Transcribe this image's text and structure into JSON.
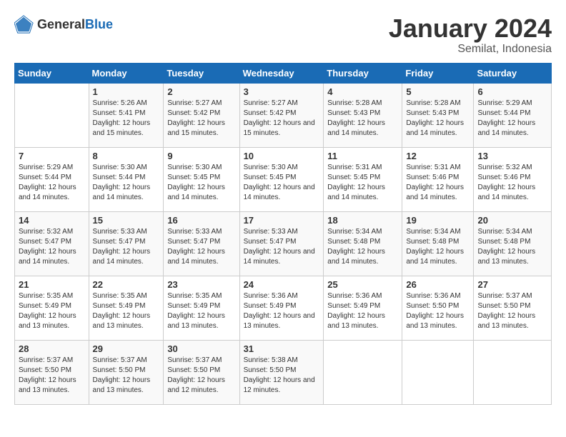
{
  "logo": {
    "general": "General",
    "blue": "Blue"
  },
  "title": "January 2024",
  "subtitle": "Semilat, Indonesia",
  "days_header": [
    "Sunday",
    "Monday",
    "Tuesday",
    "Wednesday",
    "Thursday",
    "Friday",
    "Saturday"
  ],
  "weeks": [
    [
      {
        "day": "",
        "sunrise": "",
        "sunset": "",
        "daylight": ""
      },
      {
        "day": "1",
        "sunrise": "Sunrise: 5:26 AM",
        "sunset": "Sunset: 5:41 PM",
        "daylight": "Daylight: 12 hours and 15 minutes."
      },
      {
        "day": "2",
        "sunrise": "Sunrise: 5:27 AM",
        "sunset": "Sunset: 5:42 PM",
        "daylight": "Daylight: 12 hours and 15 minutes."
      },
      {
        "day": "3",
        "sunrise": "Sunrise: 5:27 AM",
        "sunset": "Sunset: 5:42 PM",
        "daylight": "Daylight: 12 hours and 15 minutes."
      },
      {
        "day": "4",
        "sunrise": "Sunrise: 5:28 AM",
        "sunset": "Sunset: 5:43 PM",
        "daylight": "Daylight: 12 hours and 14 minutes."
      },
      {
        "day": "5",
        "sunrise": "Sunrise: 5:28 AM",
        "sunset": "Sunset: 5:43 PM",
        "daylight": "Daylight: 12 hours and 14 minutes."
      },
      {
        "day": "6",
        "sunrise": "Sunrise: 5:29 AM",
        "sunset": "Sunset: 5:44 PM",
        "daylight": "Daylight: 12 hours and 14 minutes."
      }
    ],
    [
      {
        "day": "7",
        "sunrise": "Sunrise: 5:29 AM",
        "sunset": "Sunset: 5:44 PM",
        "daylight": "Daylight: 12 hours and 14 minutes."
      },
      {
        "day": "8",
        "sunrise": "Sunrise: 5:30 AM",
        "sunset": "Sunset: 5:44 PM",
        "daylight": "Daylight: 12 hours and 14 minutes."
      },
      {
        "day": "9",
        "sunrise": "Sunrise: 5:30 AM",
        "sunset": "Sunset: 5:45 PM",
        "daylight": "Daylight: 12 hours and 14 minutes."
      },
      {
        "day": "10",
        "sunrise": "Sunrise: 5:30 AM",
        "sunset": "Sunset: 5:45 PM",
        "daylight": "Daylight: 12 hours and 14 minutes."
      },
      {
        "day": "11",
        "sunrise": "Sunrise: 5:31 AM",
        "sunset": "Sunset: 5:45 PM",
        "daylight": "Daylight: 12 hours and 14 minutes."
      },
      {
        "day": "12",
        "sunrise": "Sunrise: 5:31 AM",
        "sunset": "Sunset: 5:46 PM",
        "daylight": "Daylight: 12 hours and 14 minutes."
      },
      {
        "day": "13",
        "sunrise": "Sunrise: 5:32 AM",
        "sunset": "Sunset: 5:46 PM",
        "daylight": "Daylight: 12 hours and 14 minutes."
      }
    ],
    [
      {
        "day": "14",
        "sunrise": "Sunrise: 5:32 AM",
        "sunset": "Sunset: 5:47 PM",
        "daylight": "Daylight: 12 hours and 14 minutes."
      },
      {
        "day": "15",
        "sunrise": "Sunrise: 5:33 AM",
        "sunset": "Sunset: 5:47 PM",
        "daylight": "Daylight: 12 hours and 14 minutes."
      },
      {
        "day": "16",
        "sunrise": "Sunrise: 5:33 AM",
        "sunset": "Sunset: 5:47 PM",
        "daylight": "Daylight: 12 hours and 14 minutes."
      },
      {
        "day": "17",
        "sunrise": "Sunrise: 5:33 AM",
        "sunset": "Sunset: 5:47 PM",
        "daylight": "Daylight: 12 hours and 14 minutes."
      },
      {
        "day": "18",
        "sunrise": "Sunrise: 5:34 AM",
        "sunset": "Sunset: 5:48 PM",
        "daylight": "Daylight: 12 hours and 14 minutes."
      },
      {
        "day": "19",
        "sunrise": "Sunrise: 5:34 AM",
        "sunset": "Sunset: 5:48 PM",
        "daylight": "Daylight: 12 hours and 14 minutes."
      },
      {
        "day": "20",
        "sunrise": "Sunrise: 5:34 AM",
        "sunset": "Sunset: 5:48 PM",
        "daylight": "Daylight: 12 hours and 13 minutes."
      }
    ],
    [
      {
        "day": "21",
        "sunrise": "Sunrise: 5:35 AM",
        "sunset": "Sunset: 5:49 PM",
        "daylight": "Daylight: 12 hours and 13 minutes."
      },
      {
        "day": "22",
        "sunrise": "Sunrise: 5:35 AM",
        "sunset": "Sunset: 5:49 PM",
        "daylight": "Daylight: 12 hours and 13 minutes."
      },
      {
        "day": "23",
        "sunrise": "Sunrise: 5:35 AM",
        "sunset": "Sunset: 5:49 PM",
        "daylight": "Daylight: 12 hours and 13 minutes."
      },
      {
        "day": "24",
        "sunrise": "Sunrise: 5:36 AM",
        "sunset": "Sunset: 5:49 PM",
        "daylight": "Daylight: 12 hours and 13 minutes."
      },
      {
        "day": "25",
        "sunrise": "Sunrise: 5:36 AM",
        "sunset": "Sunset: 5:49 PM",
        "daylight": "Daylight: 12 hours and 13 minutes."
      },
      {
        "day": "26",
        "sunrise": "Sunrise: 5:36 AM",
        "sunset": "Sunset: 5:50 PM",
        "daylight": "Daylight: 12 hours and 13 minutes."
      },
      {
        "day": "27",
        "sunrise": "Sunrise: 5:37 AM",
        "sunset": "Sunset: 5:50 PM",
        "daylight": "Daylight: 12 hours and 13 minutes."
      }
    ],
    [
      {
        "day": "28",
        "sunrise": "Sunrise: 5:37 AM",
        "sunset": "Sunset: 5:50 PM",
        "daylight": "Daylight: 12 hours and 13 minutes."
      },
      {
        "day": "29",
        "sunrise": "Sunrise: 5:37 AM",
        "sunset": "Sunset: 5:50 PM",
        "daylight": "Daylight: 12 hours and 13 minutes."
      },
      {
        "day": "30",
        "sunrise": "Sunrise: 5:37 AM",
        "sunset": "Sunset: 5:50 PM",
        "daylight": "Daylight: 12 hours and 12 minutes."
      },
      {
        "day": "31",
        "sunrise": "Sunrise: 5:38 AM",
        "sunset": "Sunset: 5:50 PM",
        "daylight": "Daylight: 12 hours and 12 minutes."
      },
      {
        "day": "",
        "sunrise": "",
        "sunset": "",
        "daylight": ""
      },
      {
        "day": "",
        "sunrise": "",
        "sunset": "",
        "daylight": ""
      },
      {
        "day": "",
        "sunrise": "",
        "sunset": "",
        "daylight": ""
      }
    ]
  ]
}
